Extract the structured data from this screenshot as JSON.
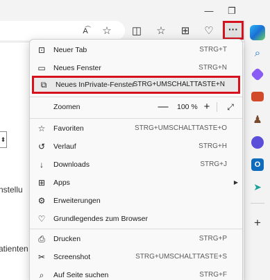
{
  "window": {
    "minimize_glyph": "—",
    "restore_glyph": "❐"
  },
  "toolbar": {
    "read_aloud_glyph": "A͡",
    "favorite_glyph": "☆",
    "split_glyph": "◫",
    "favorites_glyph": "☆",
    "collections_glyph": "⊞",
    "health_glyph": "♡",
    "more_glyph": "···"
  },
  "page": {
    "box_glyph": "⬍",
    "text_1": "nstellu",
    "text_2": "atienten"
  },
  "menu": {
    "items": [
      {
        "label": "Neuer Tab",
        "shortcut": "STRG+T",
        "icon": "new-tab-icon",
        "glyph": "⊡"
      },
      {
        "label": "Neues Fenster",
        "shortcut": "STRG+N",
        "icon": "new-window-icon",
        "glyph": "▭"
      },
      {
        "label": "Neues InPrivate-Fenster",
        "shortcut": "STRG+UMSCHALTTASTE+N",
        "icon": "inprivate-icon",
        "glyph": "⧉"
      },
      {
        "label": "Zoomen",
        "shortcut": "",
        "icon": "",
        "glyph": ""
      },
      {
        "label": "Favoriten",
        "shortcut": "STRG+UMSCHALTTASTE+O",
        "icon": "favorites-icon",
        "glyph": "☆"
      },
      {
        "label": "Verlauf",
        "shortcut": "STRG+H",
        "icon": "history-icon",
        "glyph": "↺"
      },
      {
        "label": "Downloads",
        "shortcut": "STRG+J",
        "icon": "download-icon",
        "glyph": "↓"
      },
      {
        "label": "Apps",
        "shortcut": "",
        "icon": "apps-icon",
        "glyph": "⊞"
      },
      {
        "label": "Erweiterungen",
        "shortcut": "",
        "icon": "extensions-icon",
        "glyph": "⚙"
      },
      {
        "label": "Grundlegendes zum Browser",
        "shortcut": "",
        "icon": "browser-essentials-icon",
        "glyph": "♡"
      },
      {
        "label": "Drucken",
        "shortcut": "STRG+P",
        "icon": "print-icon",
        "glyph": "⎙"
      },
      {
        "label": "Screenshot",
        "shortcut": "STRG+UMSCHALTTASTE+S",
        "icon": "screenshot-icon",
        "glyph": "✂"
      },
      {
        "label": "Auf Seite suchen",
        "shortcut": "STRG+F",
        "icon": "find-icon",
        "glyph": "⌕"
      }
    ],
    "zoom": {
      "minus": "—",
      "value": "100 %",
      "plus": "+",
      "fullscreen_glyph": "⤢"
    },
    "apps_arrow": "▶"
  },
  "sidebar": {
    "add_glyph": "+"
  },
  "colors": {
    "highlight_border": "#d6121f",
    "copilot": "#1a8fd6",
    "search": "#1a73c9",
    "shopping": "#8a5cf5",
    "tools": "#d14a2b",
    "games": "#7a4a2e",
    "office": "#5b4ed8",
    "outlook": "#0f6cbd",
    "send": "#1ba29a"
  }
}
